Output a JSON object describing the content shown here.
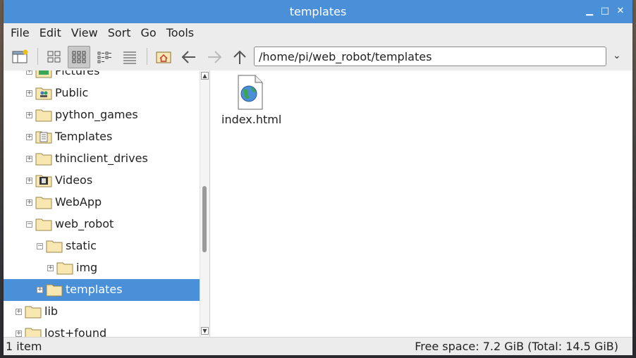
{
  "window": {
    "title": "templates"
  },
  "menu": [
    "File",
    "Edit",
    "View",
    "Sort",
    "Go",
    "Tools"
  ],
  "location": {
    "path": "/home/pi/web_robot/templates"
  },
  "tree": {
    "items": [
      {
        "label": "Pictures",
        "depth": 1,
        "expander": "+",
        "icon": "pictures-folder-icon"
      },
      {
        "label": "Public",
        "depth": 1,
        "expander": "+",
        "icon": "public-folder-icon"
      },
      {
        "label": "python_games",
        "depth": 1,
        "expander": "+",
        "icon": "folder-icon"
      },
      {
        "label": "Templates",
        "depth": 1,
        "expander": "+",
        "icon": "templates-folder-icon"
      },
      {
        "label": "thinclient_drives",
        "depth": 1,
        "expander": "+",
        "icon": "folder-icon"
      },
      {
        "label": "Videos",
        "depth": 1,
        "expander": "+",
        "icon": "videos-folder-icon"
      },
      {
        "label": "WebApp",
        "depth": 1,
        "expander": "+",
        "icon": "folder-icon"
      },
      {
        "label": "web_robot",
        "depth": 1,
        "expander": "−",
        "icon": "folder-icon"
      },
      {
        "label": "static",
        "depth": 2,
        "expander": "−",
        "icon": "folder-icon"
      },
      {
        "label": "img",
        "depth": 3,
        "expander": "+",
        "icon": "folder-icon"
      },
      {
        "label": "templates",
        "depth": 2,
        "expander": "+",
        "icon": "folder-icon",
        "selected": true
      },
      {
        "label": "lib",
        "depth": 0,
        "expander": "+",
        "icon": "folder-icon"
      },
      {
        "label": "lost+found",
        "depth": 0,
        "expander": "+",
        "icon": "folder-icon"
      }
    ]
  },
  "files": [
    {
      "name": "index.html",
      "icon": "html-file-icon"
    }
  ],
  "status": {
    "count": "1 item",
    "space": "Free space: 7.2 GiB (Total: 14.5 GiB)"
  },
  "colors": {
    "titlebar": "#4a90d9",
    "selection": "#4a90d9"
  }
}
